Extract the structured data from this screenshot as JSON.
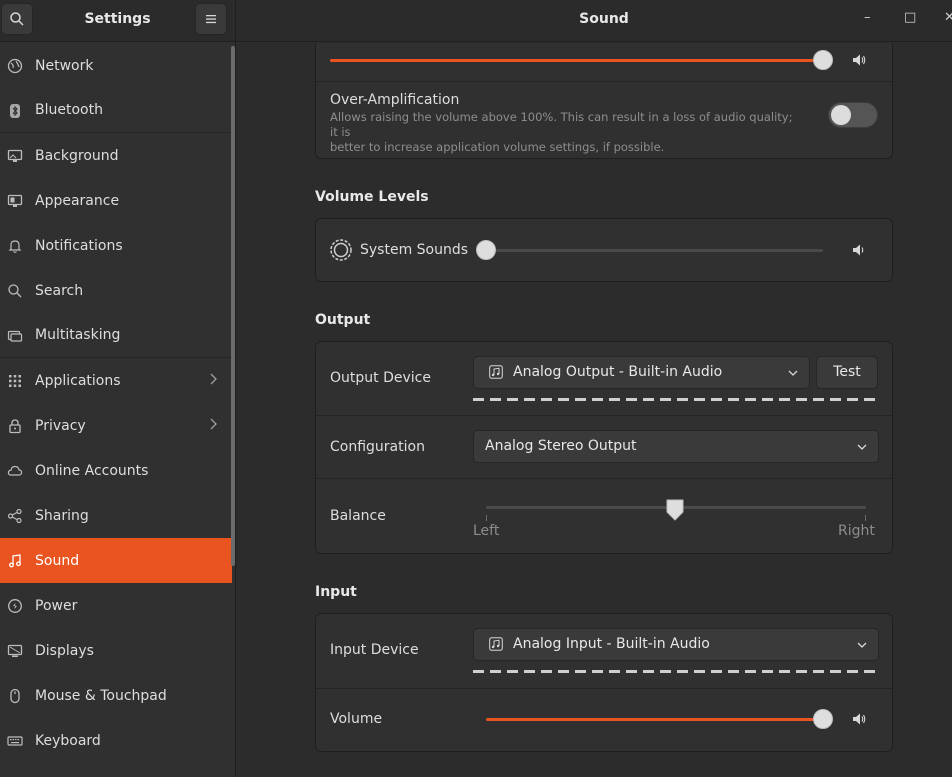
{
  "sidebar": {
    "title": "Settings",
    "items": [
      {
        "label": "Network",
        "icon": "network-icon"
      },
      {
        "label": "Bluetooth",
        "icon": "bluetooth-icon"
      },
      {
        "label": "Background",
        "icon": "background-icon"
      },
      {
        "label": "Appearance",
        "icon": "appearance-icon"
      },
      {
        "label": "Notifications",
        "icon": "bell-icon"
      },
      {
        "label": "Search",
        "icon": "search-icon"
      },
      {
        "label": "Multitasking",
        "icon": "multitasking-icon"
      },
      {
        "label": "Applications",
        "icon": "grid-icon",
        "has_arrow": true
      },
      {
        "label": "Privacy",
        "icon": "lock-icon",
        "has_arrow": true
      },
      {
        "label": "Online Accounts",
        "icon": "cloud-icon"
      },
      {
        "label": "Sharing",
        "icon": "share-icon"
      },
      {
        "label": "Sound",
        "icon": "music-note-icon",
        "active": true
      },
      {
        "label": "Power",
        "icon": "power-icon"
      },
      {
        "label": "Displays",
        "icon": "display-icon"
      },
      {
        "label": "Mouse & Touchpad",
        "icon": "mouse-icon"
      },
      {
        "label": "Keyboard",
        "icon": "keyboard-icon"
      }
    ]
  },
  "header": {
    "title": "Sound",
    "minimize": "–",
    "maximize": "□",
    "close": "✕"
  },
  "volume_panel": {
    "main_volume_level": 1.0,
    "over_amplification": {
      "label": "Over-Amplification",
      "description_line1": "Allows raising the volume above 100%. This can result in a loss of audio quality; it is",
      "description_line2": "better to increase application volume settings, if possible.",
      "enabled": false
    }
  },
  "volume_levels": {
    "title": "Volume Levels",
    "system_sounds_label": "System Sounds",
    "system_sounds_level": 0.0
  },
  "output": {
    "title": "Output",
    "device_label": "Output Device",
    "device_value": "Analog Output - Built-in Audio",
    "test_label": "Test",
    "configuration_label": "Configuration",
    "configuration_value": "Analog Stereo Output",
    "balance_label": "Balance",
    "balance_left": "Left",
    "balance_right": "Right",
    "balance_level": 0.5
  },
  "input": {
    "title": "Input",
    "device_label": "Input Device",
    "device_value": "Analog Input - Built-in Audio",
    "volume_label": "Volume",
    "volume_level": 1.0
  },
  "colors": {
    "accent": "#e95420"
  }
}
